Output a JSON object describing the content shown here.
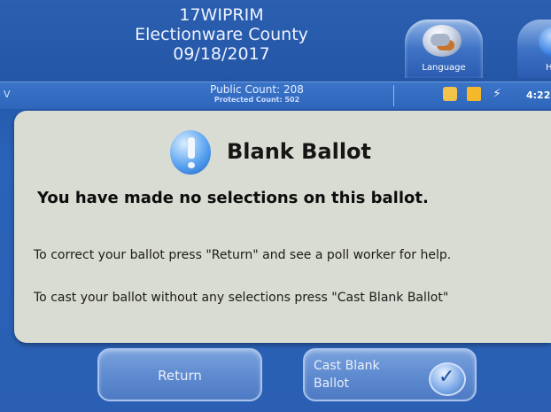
{
  "header": {
    "election_code": "17WIPRIM",
    "county": "Electionware County",
    "date": "09/18/2017"
  },
  "tabs": {
    "language_label": "Language",
    "help_label": "H"
  },
  "status_bar": {
    "left_char": "V",
    "public_count": "Public Count: 208",
    "protected_count": "Protected Count: 502",
    "time": "4:22"
  },
  "dialog": {
    "title": "Blank Ballot",
    "heading": "You have made no selections on this ballot.",
    "line1": "To correct your ballot press \"Return\" and see a poll worker for help.",
    "line2": "To cast your ballot without any selections press \"Cast Blank Ballot\""
  },
  "buttons": {
    "return_label": "Return",
    "cast_label": "Cast Blank Ballot"
  },
  "icons": {
    "language": "language-icon",
    "help": "help-icon",
    "alert": "alert-icon",
    "check": "checkmark-icon"
  },
  "colors": {
    "header_blue": "#2456a6",
    "dialog_bg": "#d9dcd2",
    "button_blue": "#5f8bd0",
    "alert_blue": "#5aa3f0"
  }
}
